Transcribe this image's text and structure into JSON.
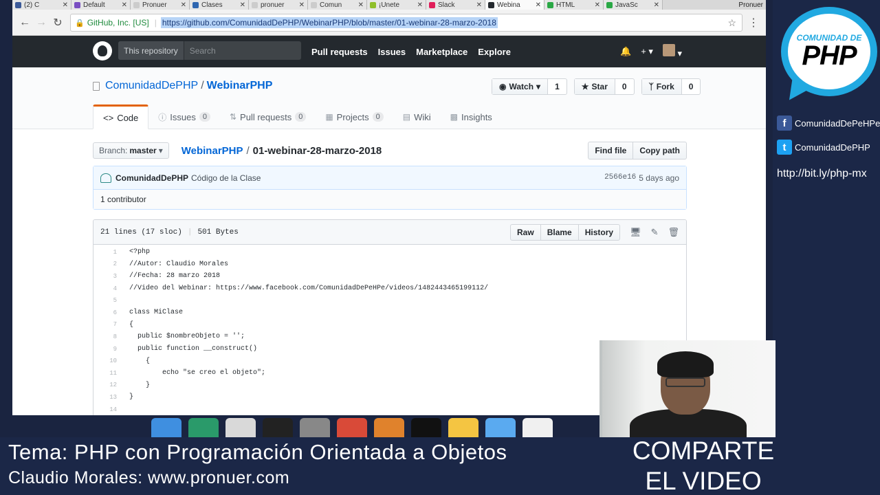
{
  "browser": {
    "tabs": [
      {
        "label": "(2) C",
        "favicon_color": "#3b5998",
        "active": false
      },
      {
        "label": "Default",
        "favicon_color": "#7a4fc2",
        "active": false
      },
      {
        "label": "Pronuer",
        "favicon_color": "#cccccc",
        "active": false
      },
      {
        "label": "Clases",
        "favicon_color": "#2e66b0",
        "active": false
      },
      {
        "label": "pronuer",
        "favicon_color": "#cccccc",
        "active": false
      },
      {
        "label": "Comun",
        "favicon_color": "#cccccc",
        "active": false
      },
      {
        "label": "¡Unete",
        "favicon_color": "#8fbf2a",
        "active": false
      },
      {
        "label": "Slack",
        "favicon_color": "#e01e5a",
        "active": false
      },
      {
        "label": "Webina",
        "favicon_color": "#24292e",
        "active": true
      },
      {
        "label": "HTML",
        "favicon_color": "#2aa845",
        "active": false
      },
      {
        "label": "JavaSc",
        "favicon_color": "#2aa845",
        "active": false
      }
    ],
    "profile_label": "Pronuer",
    "secure_org": "GitHub, Inc. [US]",
    "url": "https://github.com/ComunidadDePHP/WebinarPHP/blob/master/01-webinar-28-marzo-2018"
  },
  "github": {
    "scope": "This repository",
    "search_placeholder": "Search",
    "nav": [
      "Pull requests",
      "Issues",
      "Marketplace",
      "Explore"
    ],
    "owner": "ComunidadDePHP",
    "repo": "WebinarPHP",
    "watch": {
      "label": "Watch",
      "count": "1"
    },
    "star": {
      "label": "Star",
      "count": "0"
    },
    "fork": {
      "label": "Fork",
      "count": "0"
    },
    "tabs": {
      "code": "Code",
      "issues": {
        "label": "Issues",
        "count": "0"
      },
      "pulls": {
        "label": "Pull requests",
        "count": "0"
      },
      "projects": {
        "label": "Projects",
        "count": "0"
      },
      "wiki": "Wiki",
      "insights": "Insights"
    },
    "branch_prefix": "Branch:",
    "branch": "master",
    "breadcrumb_repo": "WebinarPHP",
    "breadcrumb_file": "01-webinar-28-marzo-2018",
    "find_file": "Find file",
    "copy_path": "Copy path",
    "commit": {
      "author": "ComunidadDePHP",
      "message": "Código de la Clase",
      "sha": "2566e16",
      "time": "5 days ago"
    },
    "contributors": "1 contributor",
    "file_info": {
      "lines": "21 lines (17 sloc)",
      "size": "501 Bytes"
    },
    "file_actions": [
      "Raw",
      "Blame",
      "History"
    ],
    "code_lines": [
      {
        "n": "1",
        "t": "<?php"
      },
      {
        "n": "2",
        "t": "//Autor: Claudio Morales"
      },
      {
        "n": "3",
        "t": "//Fecha: 28 marzo 2018"
      },
      {
        "n": "4",
        "t": "//Video del Webinar: https://www.facebook.com/ComunidadDePeHPe/videos/1482443465199112/"
      },
      {
        "n": "5",
        "t": ""
      },
      {
        "n": "6",
        "t": "class MiClase"
      },
      {
        "n": "7",
        "t": "{"
      },
      {
        "n": "8",
        "t": "  public $nombreObjeto = '';"
      },
      {
        "n": "9",
        "t": "  public function __construct()"
      },
      {
        "n": "10",
        "t": "    {"
      },
      {
        "n": "11",
        "t": "        echo \"se creo el objeto\";"
      },
      {
        "n": "12",
        "t": "    }"
      },
      {
        "n": "13",
        "t": "}"
      },
      {
        "n": "14",
        "t": ""
      }
    ]
  },
  "overlay": {
    "logo_small": "COMUNIDAD DE",
    "logo_big": "PHP",
    "facebook": "ComunidadDePeHPe",
    "twitter": "ComunidadDePHP",
    "site_link": "http://bit.ly/php-mx",
    "topic": "Tema: PHP con Programación Orientada a Objetos",
    "presenter": "Claudio Morales: www.pronuer.com",
    "share_line1": "COMPARTE",
    "share_line2": "EL VIDEO"
  }
}
